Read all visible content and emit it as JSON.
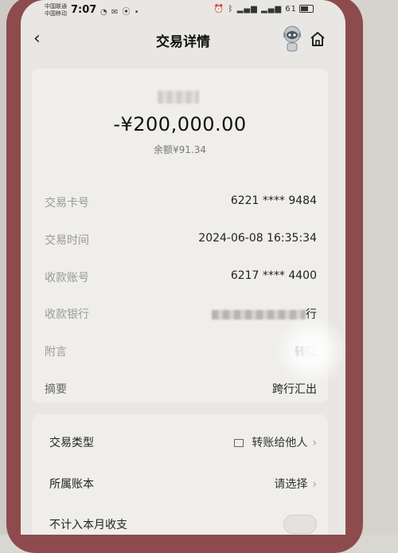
{
  "status_bar": {
    "carrier1": "中国联通",
    "carrier2": "中国移动",
    "time": "7:07",
    "battery": "61"
  },
  "header": {
    "title": "交易详情"
  },
  "transaction": {
    "amount": "-¥200,000.00",
    "balance": "余额¥91.34"
  },
  "details": [
    {
      "label": "交易卡号",
      "value": "6221 **** 9484"
    },
    {
      "label": "交易时间",
      "value": "2024-06-08 16:35:34"
    },
    {
      "label": "收款账号",
      "value": "6217 **** 4400"
    },
    {
      "label": "收款银行",
      "value": "行"
    },
    {
      "label": "附言",
      "value": "转账"
    },
    {
      "label": "摘要",
      "value": "跨行汇出"
    }
  ],
  "settings": [
    {
      "label": "交易类型",
      "value": "转账给他人"
    },
    {
      "label": "所属账本",
      "value": "请选择"
    },
    {
      "label": "不计入本月收支",
      "value": ""
    }
  ]
}
